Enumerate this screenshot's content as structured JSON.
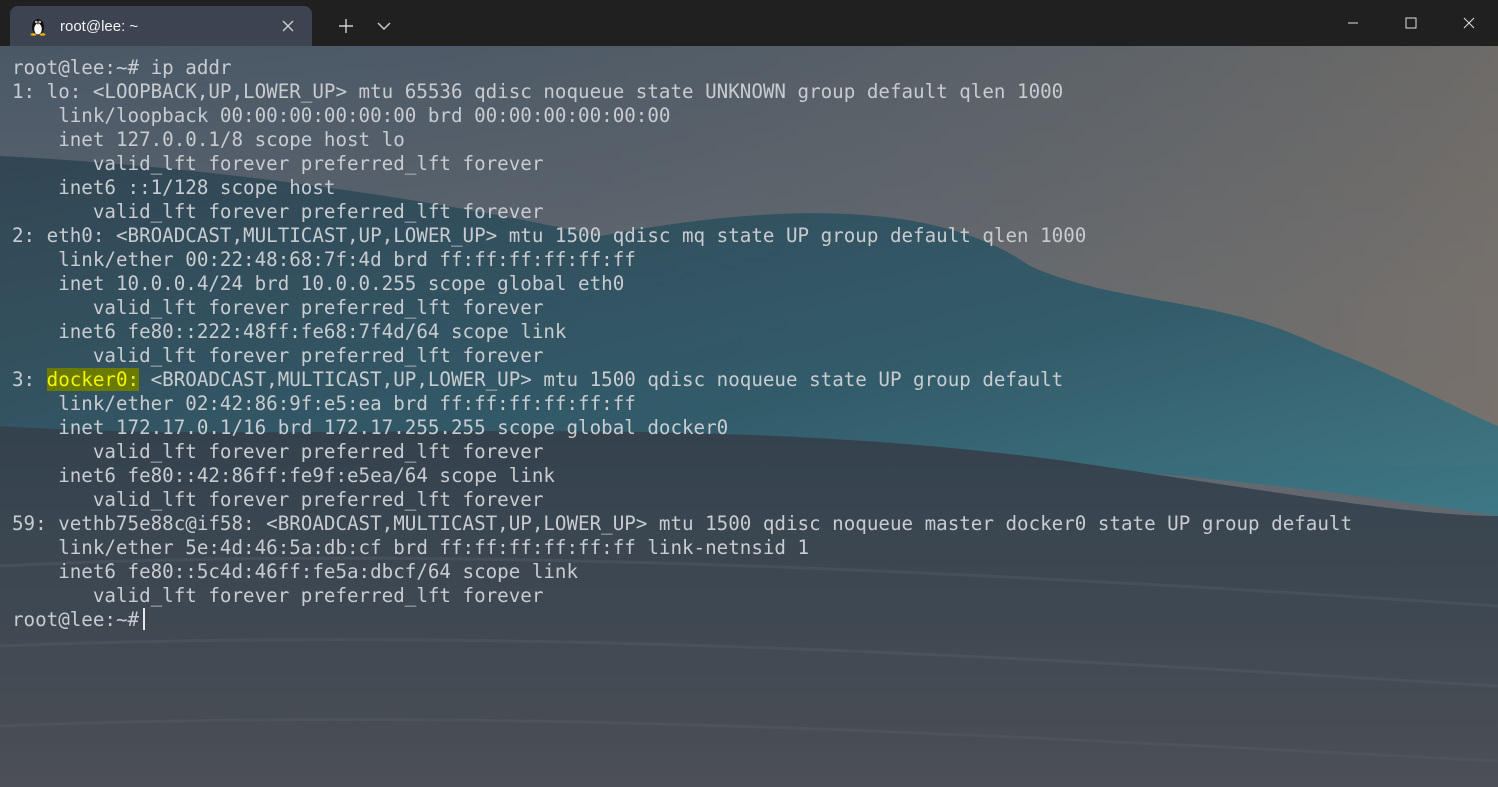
{
  "tab": {
    "title": "root@lee: ~",
    "icon": "linux-penguin-icon"
  },
  "toolbar": {
    "new_tab_icon": "plus-icon",
    "dropdown_icon": "chevron-down-icon"
  },
  "window_controls": [
    "minimize-icon",
    "maximize-icon",
    "close-icon"
  ],
  "colors": {
    "titlebar": "#202020",
    "tab_active": "#3b4450",
    "text": "#c8ccd0",
    "highlight_bg": "#6b7a00",
    "highlight_fg": "#f4f400"
  },
  "terminal": {
    "lines": [
      "root@lee:~# ip addr",
      "1: lo: <LOOPBACK,UP,LOWER_UP> mtu 65536 qdisc noqueue state UNKNOWN group default qlen 1000",
      "    link/loopback 00:00:00:00:00:00 brd 00:00:00:00:00:00",
      "    inet 127.0.0.1/8 scope host lo",
      "       valid_lft forever preferred_lft forever",
      "    inet6 ::1/128 scope host",
      "       valid_lft forever preferred_lft forever",
      "2: eth0: <BROADCAST,MULTICAST,UP,LOWER_UP> mtu 1500 qdisc mq state UP group default qlen 1000",
      "    link/ether 00:22:48:68:7f:4d brd ff:ff:ff:ff:ff:ff",
      "    inet 10.0.0.4/24 brd 10.0.0.255 scope global eth0",
      "       valid_lft forever preferred_lft forever",
      "    inet6 fe80::222:48ff:fe68:7f4d/64 scope link",
      "       valid_lft forever preferred_lft forever",
      {
        "prefix": "3: ",
        "highlight": "docker0:",
        "suffix": " <BROADCAST,MULTICAST,UP,LOWER_UP> mtu 1500 qdisc noqueue state UP group default"
      },
      "    link/ether 02:42:86:9f:e5:ea brd ff:ff:ff:ff:ff:ff",
      "    inet 172.17.0.1/16 brd 172.17.255.255 scope global docker0",
      "       valid_lft forever preferred_lft forever",
      "    inet6 fe80::42:86ff:fe9f:e5ea/64 scope link",
      "       valid_lft forever preferred_lft forever",
      "59: vethb75e88c@if58: <BROADCAST,MULTICAST,UP,LOWER_UP> mtu 1500 qdisc noqueue master docker0 state UP group default",
      "    link/ether 5e:4d:46:5a:db:cf brd ff:ff:ff:ff:ff:ff link-netnsid 1",
      "    inet6 fe80::5c4d:46ff:fe5a:dbcf/64 scope link",
      "       valid_lft forever preferred_lft forever"
    ],
    "prompt": "root@lee:~# "
  }
}
